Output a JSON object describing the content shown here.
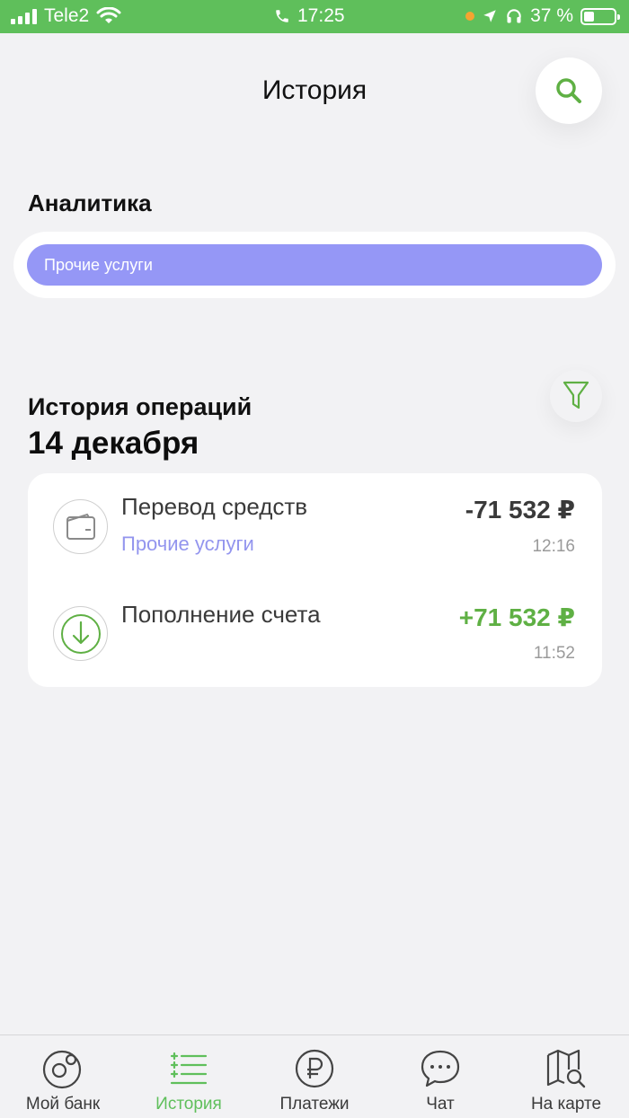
{
  "status_bar": {
    "carrier": "Tele2",
    "time": "17:25",
    "battery": "37 %"
  },
  "header": {
    "title": "История"
  },
  "analytics": {
    "title": "Аналитика",
    "bar_label": "Прочие услуги",
    "bar_color": "#9597f6"
  },
  "history": {
    "title": "История операций",
    "date": "14 декабря",
    "operations": [
      {
        "name": "Перевод средств",
        "category": "Прочие услуги",
        "amount": "-71 532 ₽",
        "time": "12:16",
        "icon": "wallet-icon",
        "amount_color": "#3a3a3a"
      },
      {
        "name": "Пополнение счета",
        "category": "",
        "amount": "+71 532 ₽",
        "time": "11:52",
        "icon": "download-arrow-icon",
        "amount_color": "#5fb044"
      }
    ]
  },
  "tab_bar": {
    "tabs": [
      {
        "label": "Мой банк",
        "icon": "my-bank-icon",
        "active": false
      },
      {
        "label": "История",
        "icon": "history-list-icon",
        "active": true
      },
      {
        "label": "Платежи",
        "icon": "ruble-icon",
        "active": false
      },
      {
        "label": "Чат",
        "icon": "chat-bubble-icon",
        "active": false
      },
      {
        "label": "На карте",
        "icon": "map-search-icon",
        "active": false
      }
    ]
  },
  "colors": {
    "accent": "#5fbf5b",
    "background": "#f2f2f4"
  }
}
